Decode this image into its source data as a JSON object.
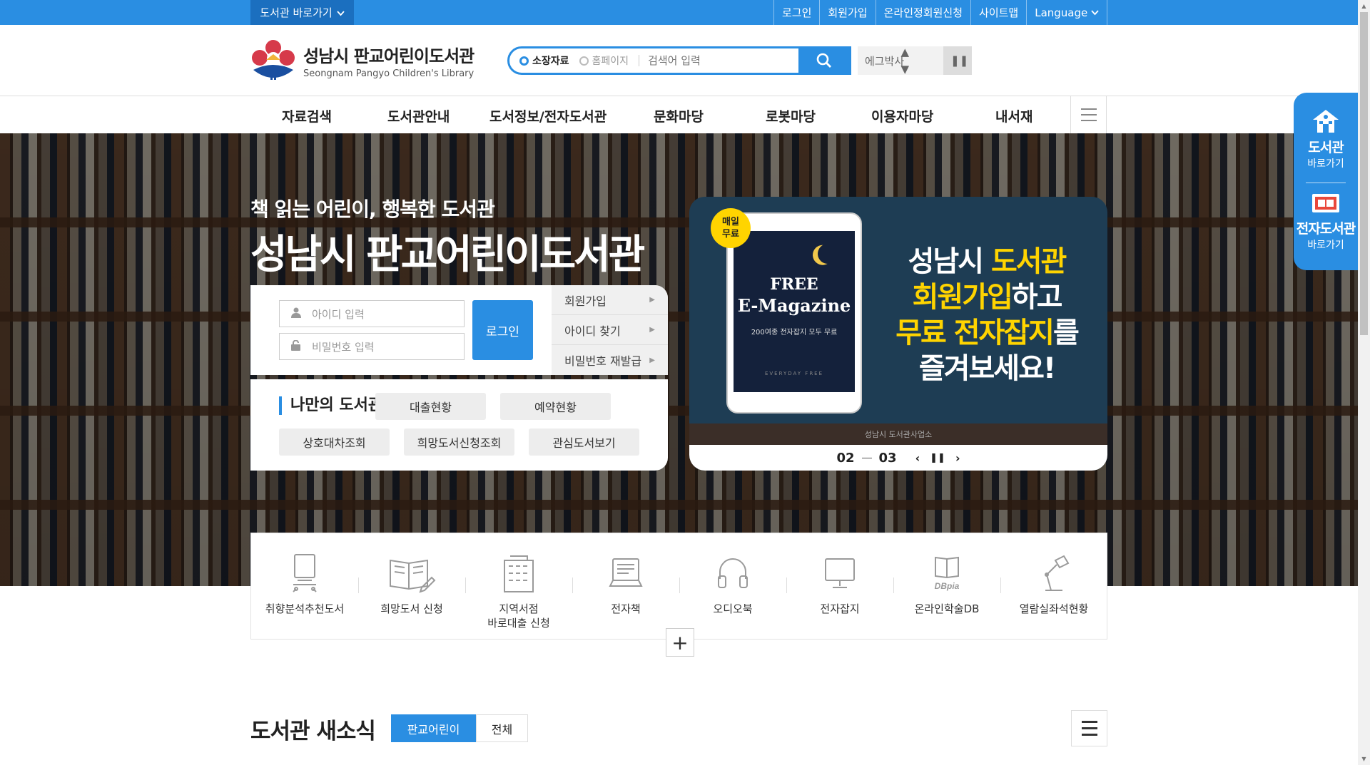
{
  "topbar": {
    "shortcut_label": "도서관 바로가기",
    "utility_links": [
      "로그인",
      "회원가입",
      "온라인정회원신청",
      "사이트맵",
      "Language"
    ]
  },
  "header": {
    "logo_title": "성남시 판교어린이도서관",
    "logo_subtitle": "Seongnam Pangyo Children's Library",
    "search": {
      "options": [
        "소장자료",
        "홈페이지"
      ],
      "selected": "소장자료",
      "placeholder": "검색어 입력"
    },
    "ticker_text": "에그박사"
  },
  "gnb": [
    "자료검색",
    "도서관안내",
    "도서정보/전자도서관",
    "문화마당",
    "로봇마당",
    "이용자마당",
    "내서재"
  ],
  "hero": {
    "subtitle": "책 읽는 어린이, 행복한 도서관",
    "title": "성남시 판교어린이도서관"
  },
  "login": {
    "id_placeholder": "아이디 입력",
    "pw_placeholder": "비밀번호 입력",
    "button": "로그인",
    "links": [
      "회원가입",
      "아이디 찾기",
      "비밀번호 재발급"
    ]
  },
  "mylib": {
    "title": "나만의 도서관",
    "buttons": [
      "대출현황",
      "예약현황",
      "상호대차조회",
      "희망도서신청조회",
      "관심도서보기"
    ]
  },
  "banner": {
    "badge": "매일 무료",
    "tablet_free": "FREE",
    "tablet_mag": "E-Magazine",
    "tablet_desc": "200여종 전자잡지 모두 무료",
    "tablet_every": "EVERYDAY FREE",
    "text_line1_a": "성남시 ",
    "text_line1_b": "도서관",
    "text_line2_a": "회원가입",
    "text_line2_b": "하고",
    "text_line3_a": "무료 전자잡지",
    "text_line3_b": "를",
    "text_line4": "즐겨보세요!",
    "footer": "성남시 도서관사업소",
    "current": "02",
    "total": "03",
    "accent": "#ffd400"
  },
  "quick_menu": [
    {
      "label": "취향분석추천도서",
      "icon": "kiosk-icon"
    },
    {
      "label": "희망도서 신청",
      "icon": "book-pen-icon"
    },
    {
      "label": "지역서점\n바로대출 신청",
      "icon": "building-icon"
    },
    {
      "label": "전자책",
      "icon": "laptop-icon"
    },
    {
      "label": "오디오북",
      "icon": "headphones-icon"
    },
    {
      "label": "전자잡지",
      "icon": "monitor-icon"
    },
    {
      "label": "온라인학술DB",
      "icon": "dbpia-icon"
    },
    {
      "label": "열람실좌석현황",
      "icon": "desk-lamp-icon"
    }
  ],
  "news": {
    "title": "도서관 새소식",
    "tabs": [
      "판교어린이",
      "전체"
    ],
    "active_tab": "판교어린이"
  },
  "side_quick": [
    {
      "big": "도서관",
      "small": "바로가기"
    },
    {
      "big": "전자도서관",
      "small": "바로가기"
    }
  ],
  "colors": {
    "primary": "#2a8ee2",
    "dark_blue": "#1b6fbf"
  }
}
